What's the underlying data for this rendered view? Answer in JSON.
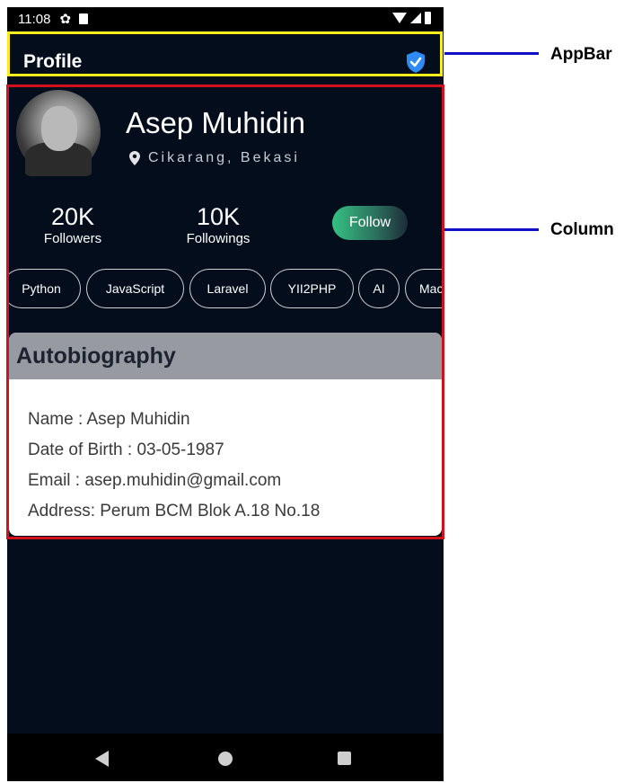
{
  "statusbar": {
    "time": "11:08"
  },
  "appbar": {
    "title": "Profile"
  },
  "profile": {
    "name": "Asep Muhidin",
    "location": "Cikarang, Bekasi",
    "stats": [
      {
        "value": "20K",
        "label": "Followers"
      },
      {
        "value": "10K",
        "label": "Followings"
      }
    ],
    "follow_label": "Follow"
  },
  "skills": [
    "Python",
    "JavaScript",
    "Laravel",
    "YII2PHP",
    "AI",
    "Mac"
  ],
  "autobiography": {
    "title": "Autobiography",
    "lines": [
      "Name : Asep Muhidin",
      "Date of Birth : 03-05-1987",
      "Email : asep.muhidin@gmail.com",
      "Address: Perum BCM Blok A.18 No.18"
    ]
  },
  "annotations": {
    "appbar_label": "AppBar",
    "column_label": "Column"
  },
  "colors": {
    "background": "#030d1c",
    "appbar_highlight": "#f7ee1b",
    "column_highlight": "#d1121c",
    "callout": "#1010c8",
    "shield": "#2e8bf5"
  }
}
